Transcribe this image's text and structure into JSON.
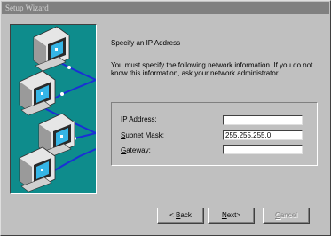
{
  "window": {
    "title": "Setup Wizard"
  },
  "page": {
    "heading": "Specify an IP Address",
    "description": "You must specify the following network information. If you do not know this information, ask your network administrator."
  },
  "fields": [
    {
      "label": "IP Address:",
      "mnemonic": "",
      "rest": "",
      "value": ""
    },
    {
      "label": "",
      "mnemonic": "S",
      "rest": "ubnet Mask:",
      "value": "255.255.255.0"
    },
    {
      "label": "",
      "mnemonic": "G",
      "rest": "ateway:",
      "value": ""
    }
  ],
  "buttons": {
    "back": {
      "prefix": "< ",
      "mnemonic": "B",
      "rest": "ack"
    },
    "next": {
      "mnemonic": "N",
      "rest": "ext>"
    },
    "cancel": {
      "mnemonic": "C",
      "rest": "ancel",
      "disabled": true
    }
  },
  "colors": {
    "art_background": "#0e8c8c",
    "network_cable": "#1a2fd6",
    "titlebar": "#808080"
  },
  "icons": [
    "computer-icon",
    "network-cable-icon"
  ]
}
